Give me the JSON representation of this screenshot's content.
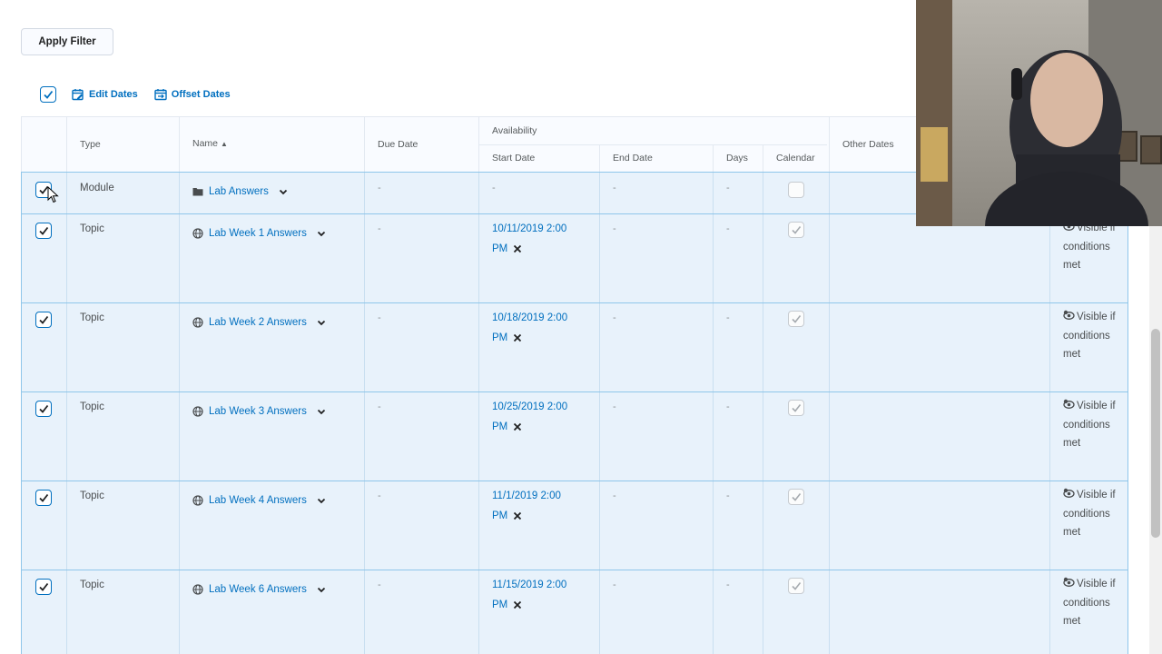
{
  "apply_filter_label": "Apply Filter",
  "toolbar": {
    "edit_dates": "Edit Dates",
    "offset_dates": "Offset Dates"
  },
  "headers": {
    "type": "Type",
    "name": "Name",
    "due_date": "Due Date",
    "availability": "Availability",
    "start_date": "Start Date",
    "end_date": "End Date",
    "days": "Days",
    "calendar": "Calendar",
    "other_dates": "Other Dates"
  },
  "rows": [
    {
      "type": "Module",
      "name": "Lab Answers",
      "icon": "folder-icon",
      "due": "-",
      "start": "-",
      "start_line1": "",
      "start_line2": "",
      "end": "-",
      "days": "-",
      "calendar_checked": false,
      "visibility": ""
    },
    {
      "type": "Topic",
      "name": "Lab Week 1 Answers",
      "icon": "globe-icon",
      "due": "-",
      "start_line1": "10/11/2019 2:00",
      "start_line2": "PM",
      "end": "-",
      "days": "-",
      "calendar_checked": true,
      "visibility": "Visible if conditions met"
    },
    {
      "type": "Topic",
      "name": "Lab Week 2 Answers",
      "icon": "globe-icon",
      "due": "-",
      "start_line1": "10/18/2019 2:00",
      "start_line2": "PM",
      "end": "-",
      "days": "-",
      "calendar_checked": true,
      "visibility": "Visible if conditions met"
    },
    {
      "type": "Topic",
      "name": "Lab Week 3 Answers",
      "icon": "globe-icon",
      "due": "-",
      "start_line1": "10/25/2019 2:00",
      "start_line2": "PM",
      "end": "-",
      "days": "-",
      "calendar_checked": true,
      "visibility": "Visible if conditions met"
    },
    {
      "type": "Topic",
      "name": "Lab Week 4 Answers",
      "icon": "globe-icon",
      "due": "-",
      "start_line1": "11/1/2019 2:00",
      "start_line2": "PM",
      "end": "-",
      "days": "-",
      "calendar_checked": true,
      "visibility": "Visible if conditions met"
    },
    {
      "type": "Topic",
      "name": "Lab Week 6 Answers",
      "icon": "globe-icon",
      "due": "-",
      "start_line1": "11/15/2019 2:00",
      "start_line2": "PM",
      "end": "-",
      "days": "-",
      "calendar_checked": true,
      "visibility": "Visible if conditions met"
    }
  ],
  "colors": {
    "accent": "#006fbf",
    "row_selected_bg": "#e8f2fb",
    "row_border": "#8fc6ea"
  }
}
